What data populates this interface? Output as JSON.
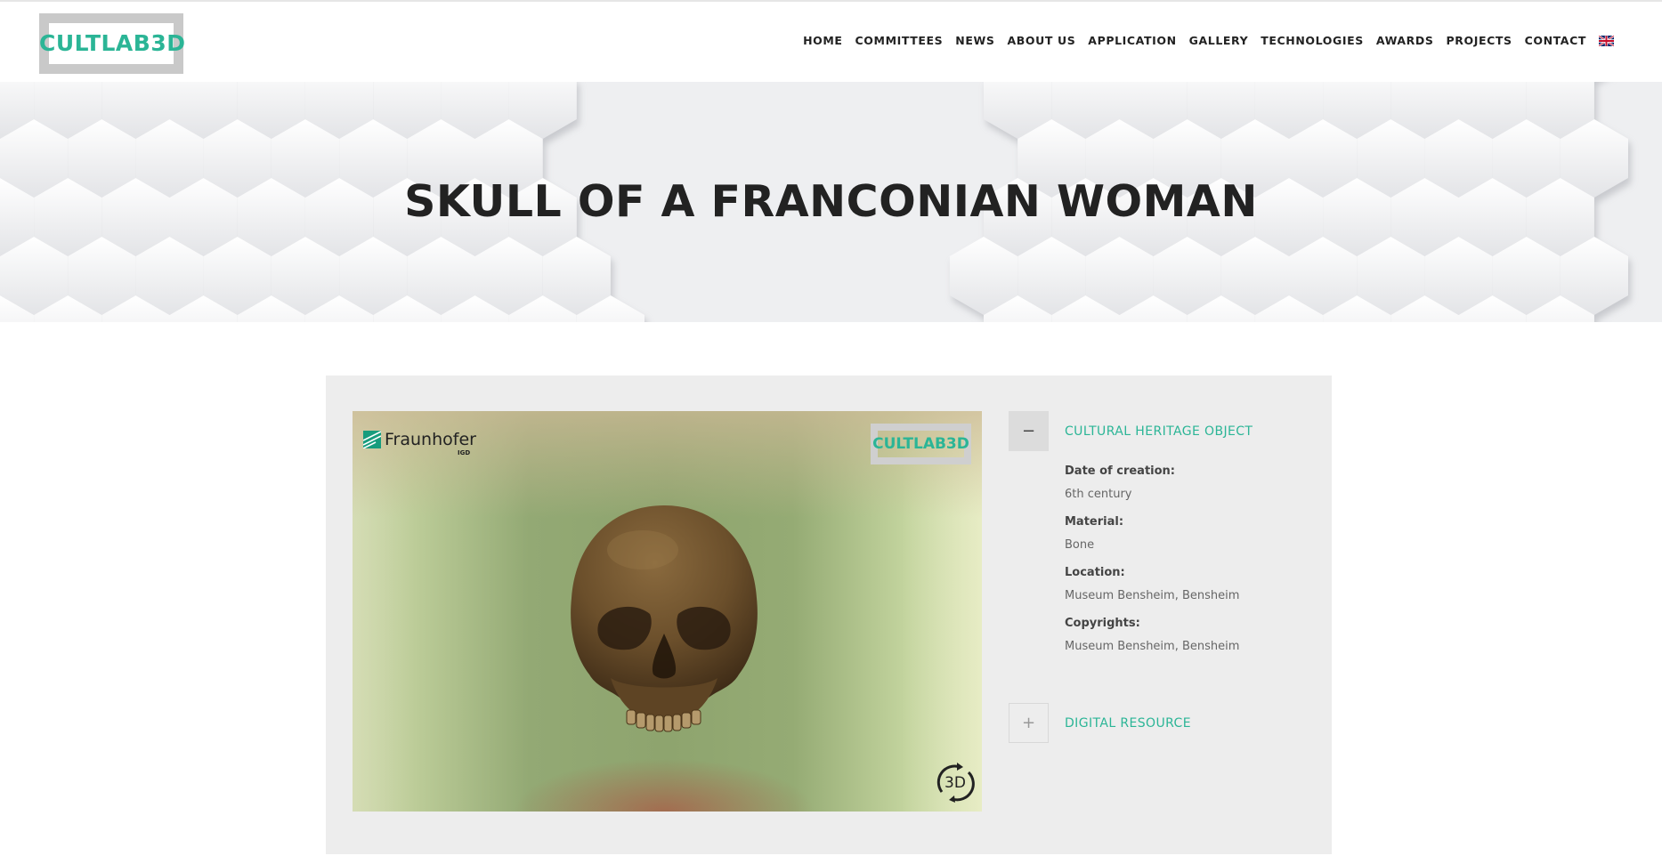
{
  "header": {
    "logo_text": "CULTLAB3D",
    "nav": [
      "HOME",
      "COMMITTEES",
      "NEWS",
      "ABOUT US",
      "APPLICATION",
      "GALLERY",
      "TECHNOLOGIES",
      "AWARDS",
      "PROJECTS",
      "CONTACT"
    ],
    "language_icon": "uk-flag-icon"
  },
  "hero": {
    "title": "SKULL OF A FRANCONIAN WOMAN"
  },
  "viewer": {
    "institution": "Fraunhofer",
    "institution_sub": "IGD",
    "watermark": "CULTLAB3D",
    "badge": "3D"
  },
  "accordion": {
    "object_section": {
      "toggle": "−",
      "title": "CULTURAL HERITAGE OBJECT"
    },
    "fields": [
      {
        "label": "Date of creation:",
        "value": "6th century"
      },
      {
        "label": "Material:",
        "value": "Bone"
      },
      {
        "label": "Location:",
        "value": "Museum Bensheim, Bensheim"
      },
      {
        "label": "Copyrights:",
        "value": "Museum Bensheim, Bensheim"
      }
    ],
    "resource_section": {
      "toggle": "+",
      "title": "DIGITAL RESOURCE"
    }
  },
  "colors": {
    "accent": "#2bb596",
    "logo_frame": "#c9c9c9",
    "card_bg": "#ededed"
  }
}
